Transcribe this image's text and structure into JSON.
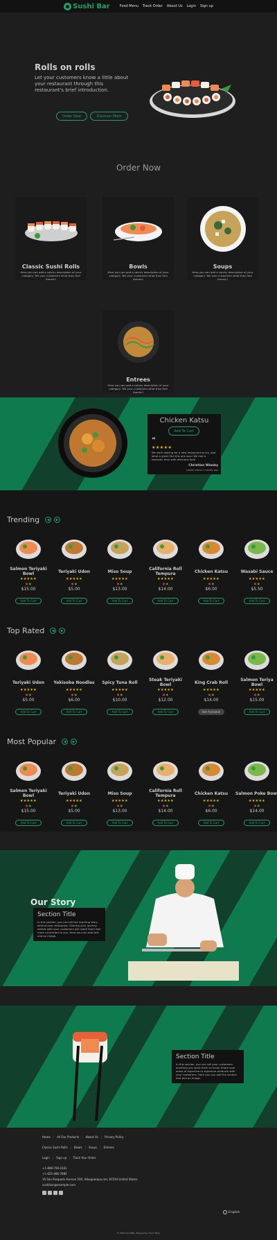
{
  "nav": {
    "brand": "Sushi Bar",
    "links": [
      "Food Menu",
      "Track Order",
      "About Us",
      "Login",
      "Sign up"
    ]
  },
  "hero": {
    "title": "Rolls on rolls",
    "text": "Let your customers know a little about your restaurant through this restaurant's brief introduction.",
    "btn_order": "Order Now",
    "btn_discover": "Discover More"
  },
  "order": {
    "heading": "Order Now",
    "desc": "Here you can add a catchy description of your category. Tell your customers what they find therein!",
    "categories": [
      "Classic Sushi Rolls",
      "Bowls",
      "Soups",
      "Entrees"
    ]
  },
  "featured": {
    "title": "Chicken Katsu",
    "btn": "Add To Cart",
    "quote_mark": "“",
    "stars": "★★★★★",
    "review": "We were looking for a new restaurant to try, and what a great find this one was! We had a fantastic time with delicious food",
    "author": "Christian Wiesky",
    "ago": "posted about 2 months ago"
  },
  "trending": {
    "title": "Trending",
    "items": [
      {
        "name": "Salmon Teriyaki Bowl",
        "price": "$15.00",
        "btn": "Add To Cart"
      },
      {
        "name": "Teriyaki Udon",
        "price": "$5.00",
        "btn": "Add To Cart"
      },
      {
        "name": "Miso Soup",
        "price": "$13.00",
        "btn": "Add To Cart"
      },
      {
        "name": "California Roll Tempura",
        "price": "$14.00",
        "btn": "Add To Cart"
      },
      {
        "name": "Chicken Katsu",
        "price": "$6.00",
        "btn": "Add To Cart"
      },
      {
        "name": "Wasabi Sauce",
        "price": "$5.50",
        "btn": "Add To Cart"
      }
    ]
  },
  "toprated": {
    "title": "Top Rated",
    "items": [
      {
        "name": "Teriyaki Udon",
        "price": "$5.00",
        "btn": "Add To Cart"
      },
      {
        "name": "Yakisoba Noodles",
        "price": "$6.00",
        "btn": "Add To Cart"
      },
      {
        "name": "Spicy Tuna Roll",
        "price": "$10.00",
        "btn": "Add To Cart"
      },
      {
        "name": "Steak Teriyaki Bowl",
        "price": "$12.00",
        "btn": "Add To Cart"
      },
      {
        "name": "King Crab Roll",
        "price": "$14.00",
        "btn": "Not Available"
      },
      {
        "name": "Salmon Teriya Bowl",
        "price": "$15.00",
        "btn": "Add To Cart"
      }
    ]
  },
  "popular": {
    "title": "Most Popular",
    "items": [
      {
        "name": "Salmon Teriyaki Bowl",
        "price": "$15.00",
        "btn": "Add To Cart"
      },
      {
        "name": "Teriyaki Udon",
        "price": "$5.00",
        "btn": "Add To Cart"
      },
      {
        "name": "Miso Soup",
        "price": "$13.00",
        "btn": "Add To Cart"
      },
      {
        "name": "California Roll Tempura",
        "price": "$14.00",
        "btn": "Add To Cart"
      },
      {
        "name": "Chicken Katsu",
        "price": "$6.00",
        "btn": "Add To Cart"
      },
      {
        "name": "Salmon Poke Bowl",
        "price": "$14.00",
        "btn": "Add To Cart"
      }
    ]
  },
  "story": {
    "heading": "Our Story",
    "card_title": "Section Title",
    "card_text": "In this section, you can tell the inspiring story behind your restaurant. Sharing your journey details with your customers will make them feel more connected to you. Here you can add text and an image."
  },
  "promo": {
    "card_title": "Section Title",
    "card_text": "In this section, you can tell your customers anything you want them to know. Share your areas of expertise or signature products with your customers. Here you can add the section text and an image."
  },
  "footer": {
    "row1": [
      "Home",
      "All Our Products",
      "About Us",
      "Privacy Policy"
    ],
    "row2": [
      "Classic Sushi Rolls",
      "Bowls",
      "Soups",
      "Entrees"
    ],
    "row3": [
      "Login",
      "Sign up",
      "Track Your Order"
    ],
    "phone1": "+1-898-794-4161",
    "phone2": "+1-625-486-7880",
    "address": "16 San Pasqualo Avenue 500, Albuquerque,nm, 81534 United States",
    "email": "sushibar@example.com",
    "language": "English",
    "copyright": "© 2023 SushiBar,  Powered by Food Tilion"
  }
}
